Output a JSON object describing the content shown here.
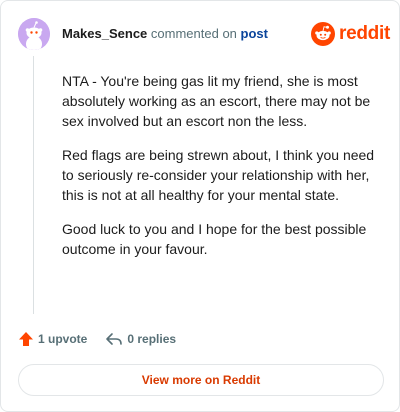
{
  "header": {
    "author": "Makes_Sence",
    "action_text": "commented on",
    "post_link": "post",
    "brand": "reddit"
  },
  "comment": {
    "paragraphs": [
      "NTA - You're being gas lit my friend, she is most absolutely working as an escort, there may not be sex involved but an escort non the less.",
      "Red flags are being strewn about, I think you need to seriously re-consider your relationship with her, this is not at all healthy for your mental state.",
      "Good luck to you and I hope for the best possible outcome in your favour."
    ]
  },
  "actions": {
    "upvotes": "1 upvote",
    "replies": "0 replies"
  },
  "footer": {
    "view_more": "View more on Reddit"
  },
  "colors": {
    "brand": "#ff4500",
    "link": "#0a449b",
    "avatar_bg": "#c9a8f0"
  },
  "icons": [
    "snoo-avatar-icon",
    "reddit-logo-icon",
    "upvote-arrow-icon",
    "reply-arrow-icon"
  ]
}
